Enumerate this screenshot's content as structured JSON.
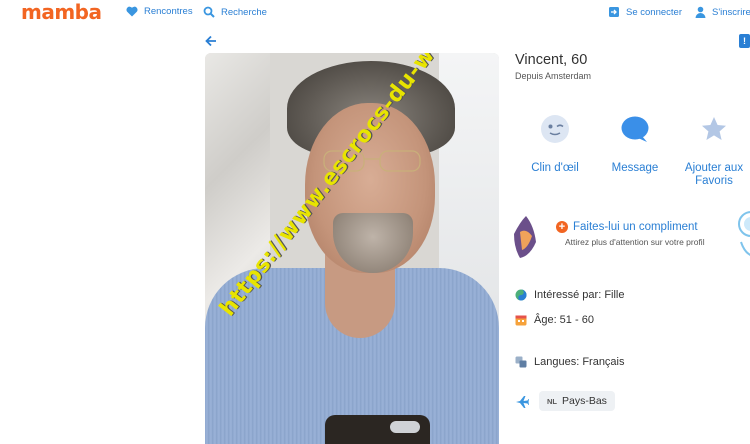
{
  "header": {
    "logo": "mamba",
    "nav": {
      "rencontres": "Rencontres",
      "recherche": "Recherche",
      "connect": "Se connecter",
      "inscrire": "S'inscrire"
    }
  },
  "profile": {
    "name_age": "Vincent, 60",
    "location": "Depuis Amsterdam",
    "photo_watermark": "https://www.escrocs-du-web.fr"
  },
  "actions": {
    "wink": "Clin d'œil",
    "message": "Message",
    "favorite_line1": "Ajouter aux",
    "favorite_line2": "Favoris"
  },
  "compliment": {
    "title": "Faites-lui un compliment",
    "subtitle": "Attirez plus d'attention sur votre profil"
  },
  "details": {
    "interest": "Intéressé par: Fille",
    "age_range": "Âge: 51 - 60",
    "languages": "Langues: Français",
    "country_code": "NL",
    "country": "Pays-Bas"
  },
  "colors": {
    "brand": "#f26522",
    "link": "#2a7fd4"
  }
}
